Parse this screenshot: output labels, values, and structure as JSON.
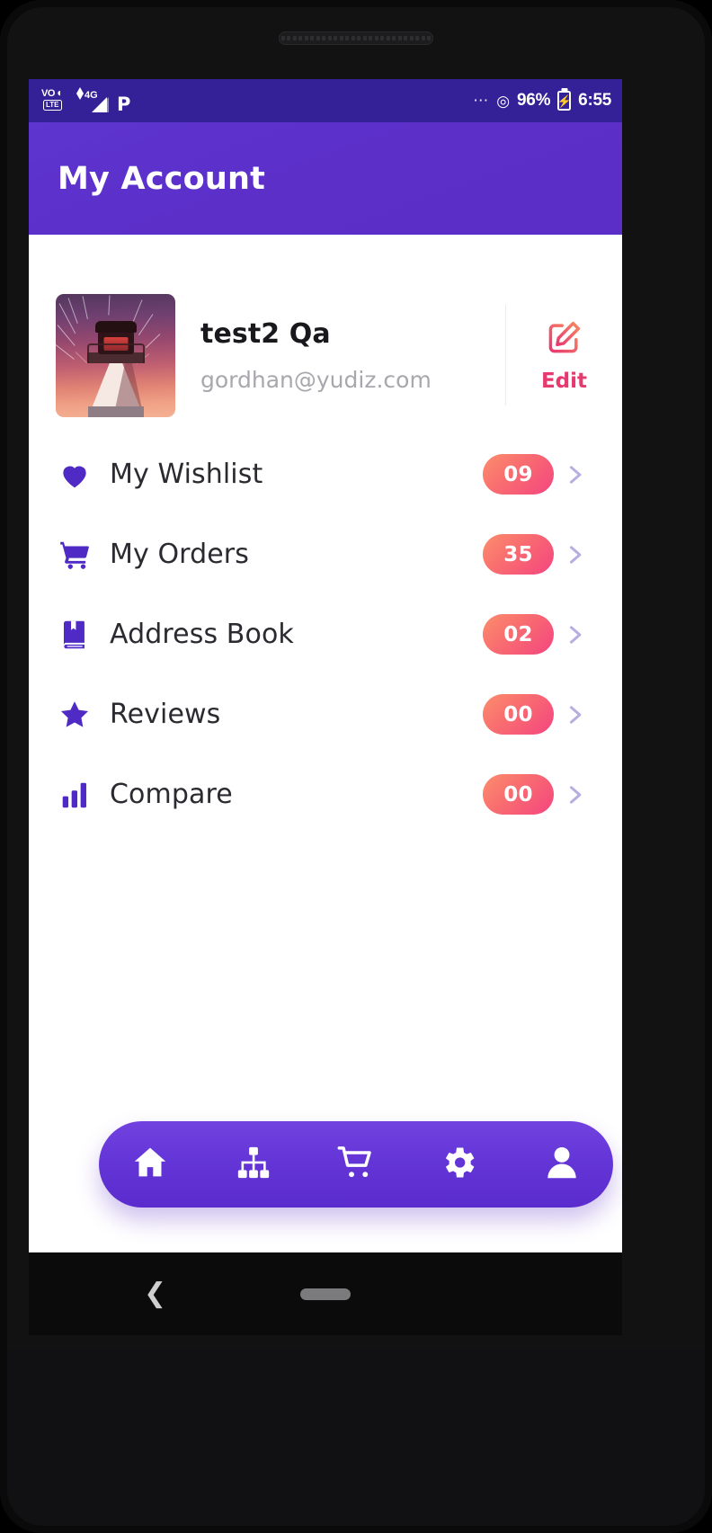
{
  "status_bar": {
    "volte_label": "VO",
    "lte_label": "LTE",
    "network_label": "4G",
    "carrier_icon": "p-icon",
    "more_icon": "overflow-dots-icon",
    "hotspot_icon": "hotspot-icon",
    "battery_percent": "96%",
    "battery_icon": "battery-charging-icon",
    "time": "6:55"
  },
  "header": {
    "title": "My Account"
  },
  "profile": {
    "avatar_icon": "lighthouse-avatar",
    "name": "test2 Qa",
    "email": "gordhan@yudiz.com",
    "edit_label": "Edit",
    "edit_icon": "edit-pencil-square-icon"
  },
  "menu": {
    "items": [
      {
        "icon": "heart-icon",
        "label": "My Wishlist",
        "count": "09",
        "chevron": "chevron-right-icon"
      },
      {
        "icon": "cart-icon",
        "label": "My Orders",
        "count": "35",
        "chevron": "chevron-right-icon"
      },
      {
        "icon": "book-icon",
        "label": "Address Book",
        "count": "02",
        "chevron": "chevron-right-icon"
      },
      {
        "icon": "star-icon",
        "label": "Reviews",
        "count": "00",
        "chevron": "chevron-right-icon"
      },
      {
        "icon": "compare-bars-icon",
        "label": "Compare",
        "count": "00",
        "chevron": "chevron-right-icon"
      }
    ]
  },
  "bottom_nav": {
    "items": [
      {
        "icon": "home-icon",
        "name": "nav-home"
      },
      {
        "icon": "sitemap-icon",
        "name": "nav-categories"
      },
      {
        "icon": "cart-icon",
        "name": "nav-cart"
      },
      {
        "icon": "gear-icon",
        "name": "nav-settings"
      },
      {
        "icon": "person-icon",
        "name": "nav-account"
      }
    ]
  },
  "system_nav": {
    "back_icon": "back-chevron-icon",
    "home_pill_icon": "home-pill-icon"
  },
  "colors": {
    "status_bar_bg": "#342097",
    "header_purple": "#5c2fc9",
    "accent_purple": "#4f2ac4",
    "badge_gradient_start": "#fb8f6e",
    "badge_gradient_end": "#f4457f",
    "edit_pink": "#e8396e",
    "nav_pill": "#6334d6"
  }
}
